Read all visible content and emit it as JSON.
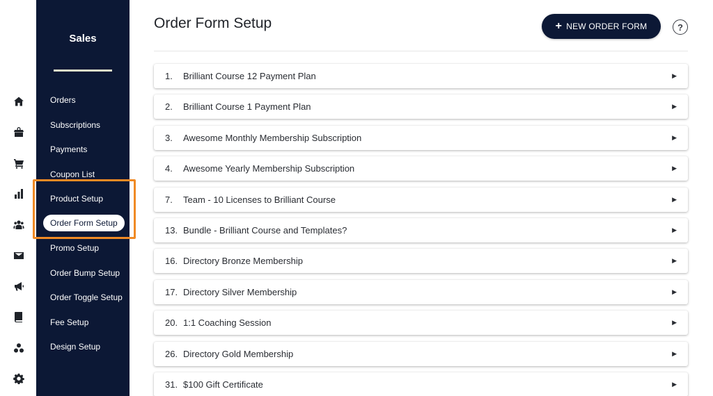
{
  "sidebar": {
    "title": "Sales",
    "items": [
      {
        "label": "Orders"
      },
      {
        "label": "Subscriptions"
      },
      {
        "label": "Payments"
      },
      {
        "label": "Coupon List"
      },
      {
        "label": "Product Setup"
      },
      {
        "label": "Order Form Setup",
        "active": true
      },
      {
        "label": "Promo Setup"
      },
      {
        "label": "Order Bump Setup"
      },
      {
        "label": "Order Toggle Setup"
      },
      {
        "label": "Fee Setup"
      },
      {
        "label": "Design Setup"
      }
    ]
  },
  "rail_icons": [
    "home-icon",
    "store-icon",
    "cart-icon",
    "bar-chart-icon",
    "users-icon",
    "mail-icon",
    "megaphone-icon",
    "book-icon",
    "circles-icon",
    "settings-icon"
  ],
  "header": {
    "title": "Order Form Setup",
    "new_button_label": "NEW ORDER FORM",
    "help_label": "?"
  },
  "order_forms": [
    {
      "num": "1.",
      "name": "Brilliant Course 12 Payment Plan"
    },
    {
      "num": "2.",
      "name": "Brilliant Course 1 Payment Plan"
    },
    {
      "num": "3.",
      "name": "Awesome Monthly Membership Subscription"
    },
    {
      "num": "4.",
      "name": "Awesome Yearly Membership Subscription"
    },
    {
      "num": "7.",
      "name": "Team - 10 Licenses to Brilliant Course"
    },
    {
      "num": "13.",
      "name": "Bundle - Brilliant Course and Templates?"
    },
    {
      "num": "16.",
      "name": "Directory Bronze Membership"
    },
    {
      "num": "17.",
      "name": "Directory Silver Membership"
    },
    {
      "num": "20.",
      "name": "1:1 Coaching Session"
    },
    {
      "num": "26.",
      "name": "Directory Gold Membership"
    },
    {
      "num": "31.",
      "name": "$100 Gift Certificate"
    }
  ],
  "colors": {
    "sidebar_bg": "#0c1835",
    "highlight": "#f08a24",
    "underline": "#dcdfc9"
  }
}
